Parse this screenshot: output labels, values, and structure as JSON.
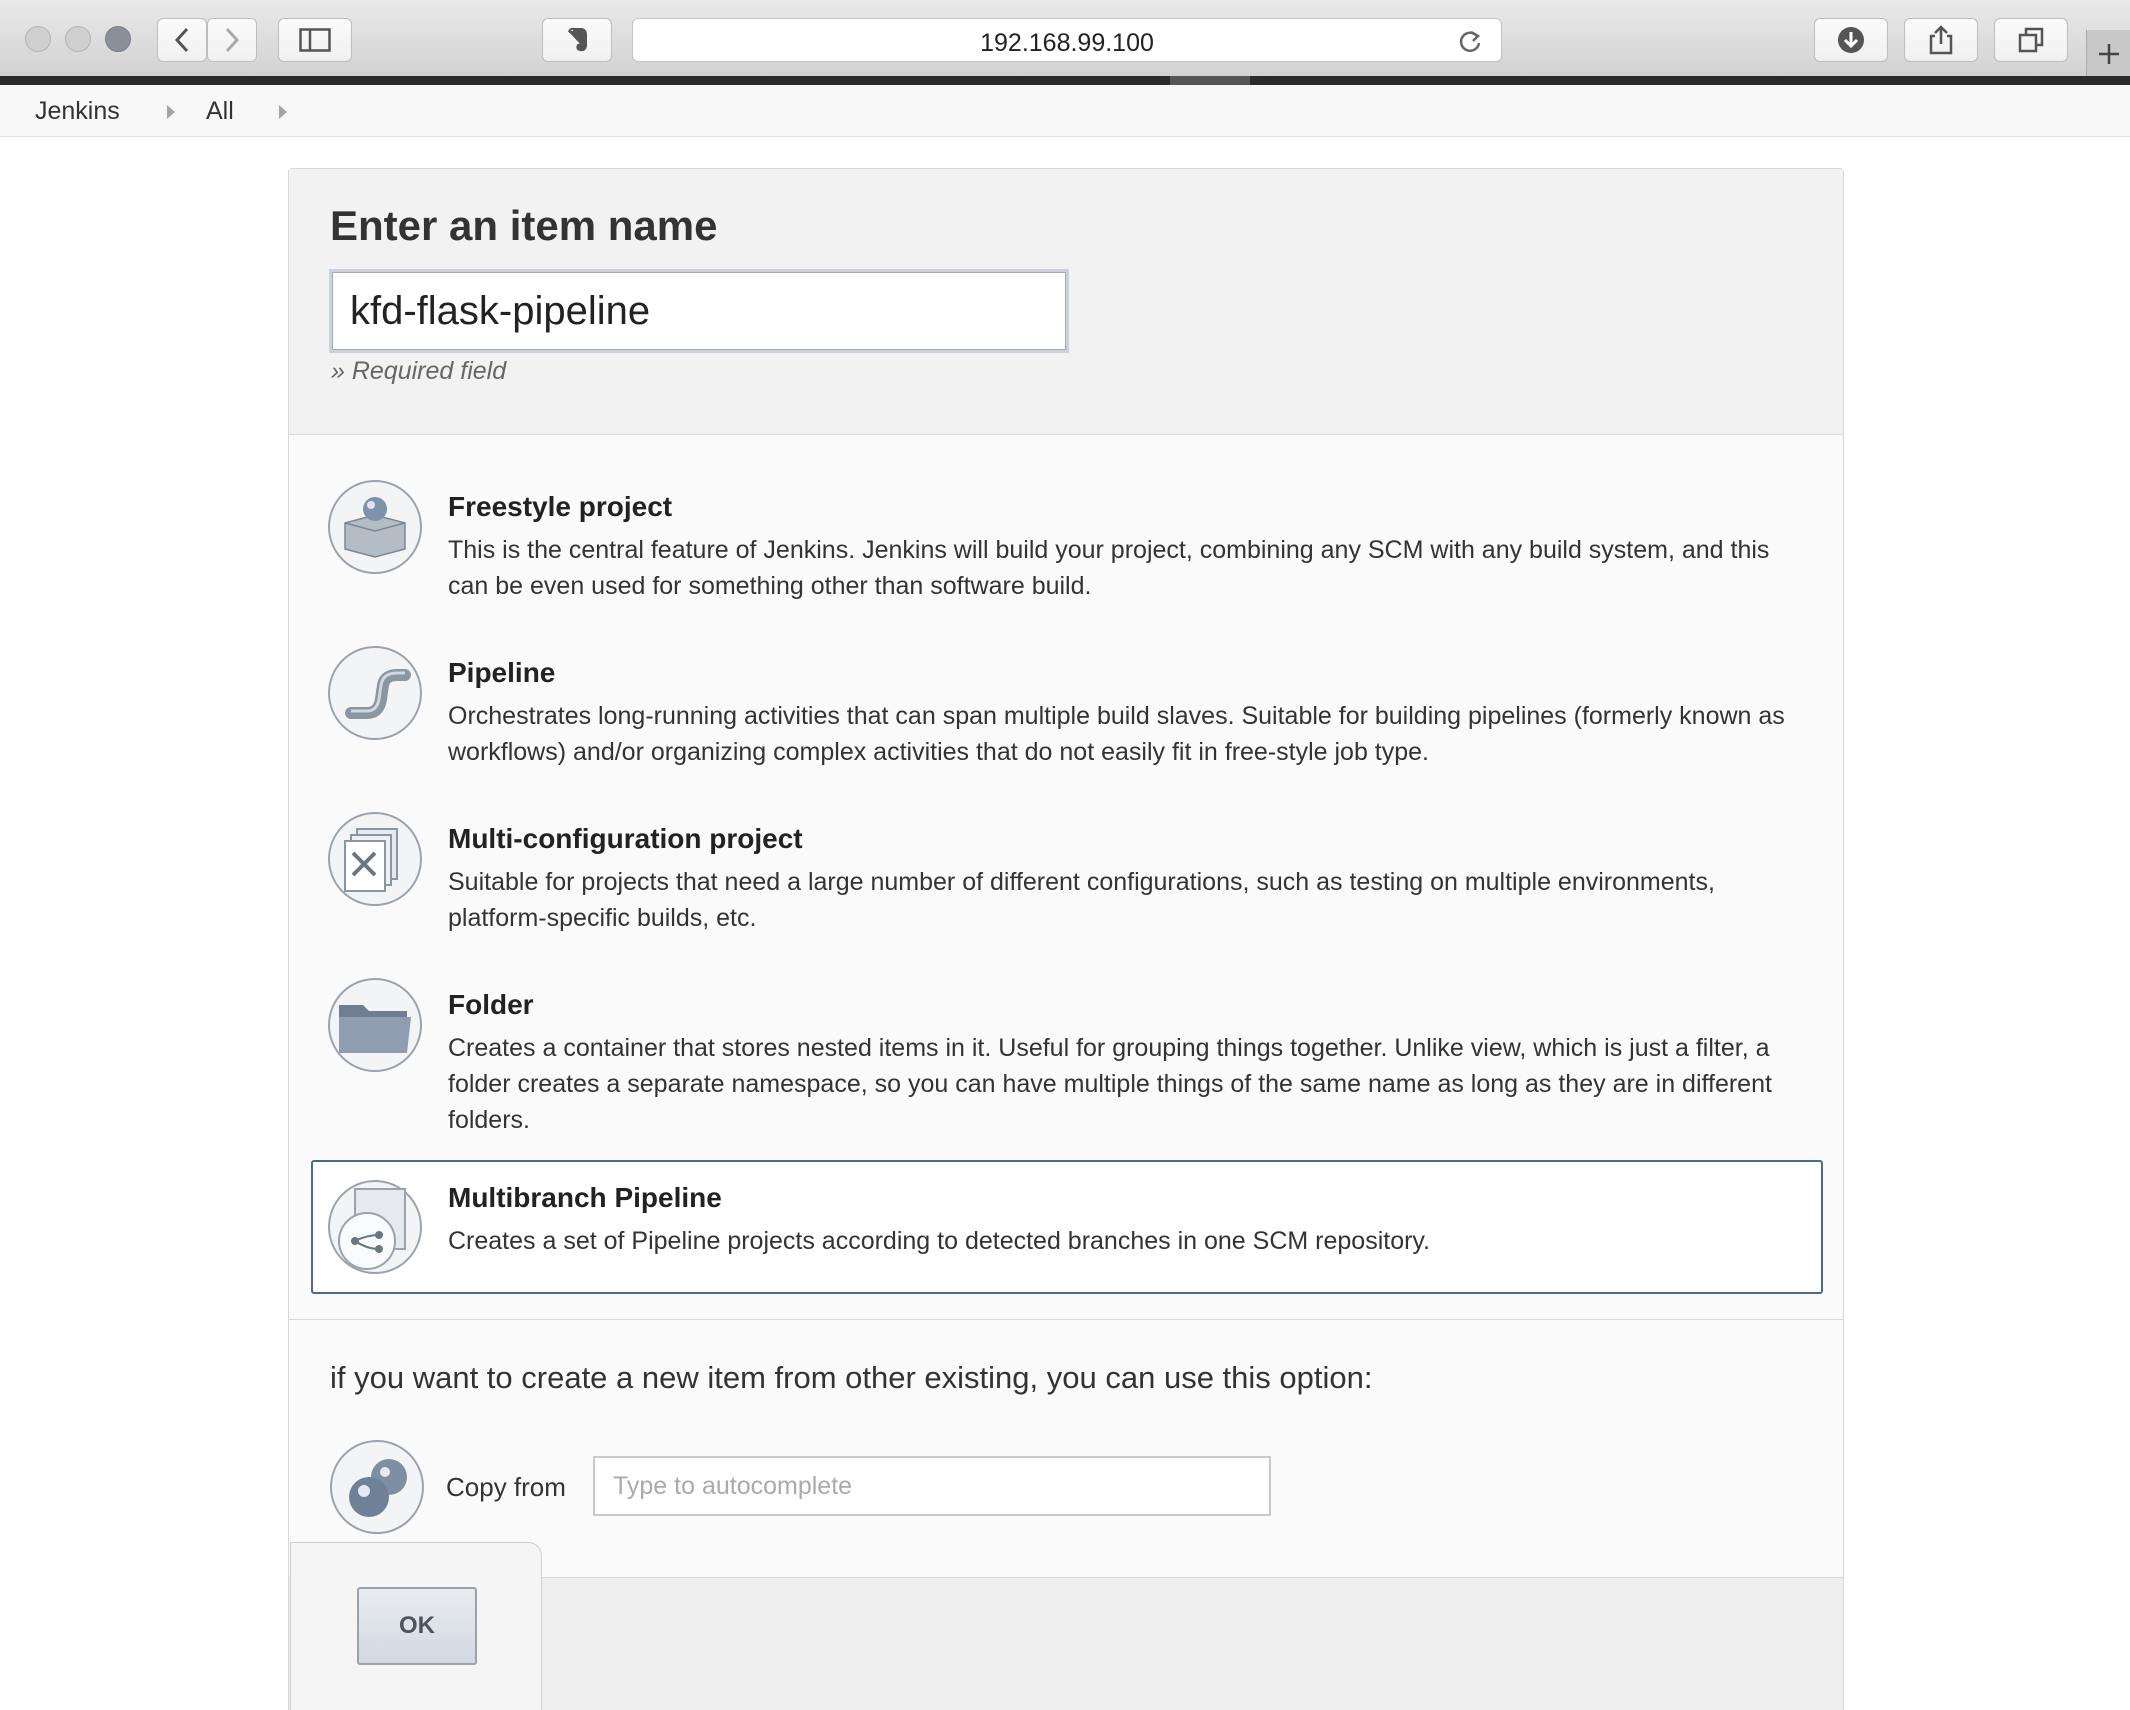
{
  "browser": {
    "url": "192.168.99.100",
    "icons": [
      "back-icon",
      "forward-icon",
      "sidebar-icon",
      "evernote-icon",
      "reload-icon",
      "download-icon",
      "share-icon",
      "tabs-icon",
      "new-tab-icon"
    ]
  },
  "breadcrumb": {
    "items": [
      "Jenkins",
      "All"
    ]
  },
  "form": {
    "title": "Enter an item name",
    "name_value": "kfd-flask-pipeline",
    "required_note": "» Required field"
  },
  "item_types": [
    {
      "title": "Freestyle project",
      "description": "This is the central feature of Jenkins. Jenkins will build your project, combining any SCM with any build system, and this can be even used for something other than software build.",
      "icon": "freestyle-box-icon"
    },
    {
      "title": "Pipeline",
      "description": "Orchestrates long-running activities that can span multiple build slaves. Suitable for building pipelines (formerly known as workflows) and/or organizing complex activities that do not easily fit in free-style job type.",
      "icon": "pipe-icon"
    },
    {
      "title": "Multi-configuration project",
      "description": "Suitable for projects that need a large number of different configurations, such as testing on multiple environments, platform-specific builds, etc.",
      "icon": "multiconfig-icon"
    },
    {
      "title": "Folder",
      "description": "Creates a container that stores nested items in it. Useful for grouping things together. Unlike view, which is just a filter, a folder creates a separate namespace, so you can have multiple things of the same name as long as they are in different folders.",
      "icon": "folder-icon"
    },
    {
      "title": "Multibranch Pipeline",
      "description": "Creates a set of Pipeline projects according to detected branches in one SCM repository.",
      "icon": "multibranch-icon",
      "selected": true
    }
  ],
  "copy": {
    "note": "if you want to create a new item from other existing, you can use this option:",
    "label": "Copy from",
    "placeholder": "Type to autocomplete"
  },
  "ok_label": "OK",
  "colors": {
    "selected_border": "#4a6b8a",
    "panel_bg": "#fafafa",
    "header_bg": "#f2f2f2"
  }
}
